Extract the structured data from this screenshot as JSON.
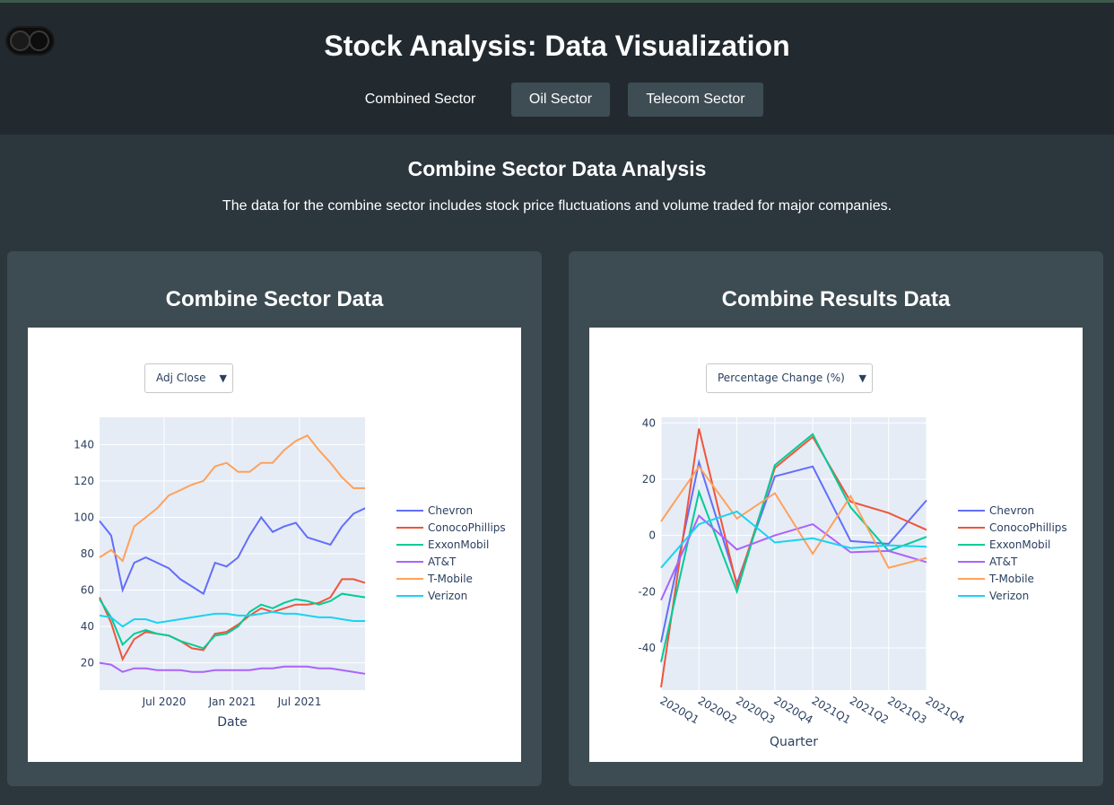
{
  "header": {
    "title": "Stock Analysis: Data Visualization",
    "tabs": [
      {
        "label": "Combined Sector"
      },
      {
        "label": "Oil Sector"
      },
      {
        "label": "Telecom Sector"
      }
    ]
  },
  "section": {
    "title": "Combine Sector Data Analysis",
    "description": "The data for the combine sector includes stock price fluctuations and volume traded for major companies."
  },
  "left_card": {
    "title": "Combine Sector Data",
    "dropdown": "Adj Close"
  },
  "right_card": {
    "title": "Combine Results Data",
    "dropdown": "Percentage Change (%)"
  },
  "colors": {
    "Chevron": "#636efa",
    "ConocoPhillips": "#ef553b",
    "ExxonMobil": "#00cc96",
    "AT&T": "#ab63fa",
    "T-Mobile": "#ffa15a",
    "Verizon": "#19d3f3"
  },
  "chart_data": [
    {
      "type": "line",
      "title": "",
      "xlabel": "Date",
      "ylabel": "",
      "x_ticks": [
        "Jul 2020",
        "Jan 2021",
        "Jul 2021"
      ],
      "y_ticks": [
        20,
        40,
        60,
        80,
        100,
        120,
        140
      ],
      "x": [
        "Jan 2020",
        "Feb 2020",
        "Mar 2020",
        "Apr 2020",
        "May 2020",
        "Jun 2020",
        "Jul 2020",
        "Aug 2020",
        "Sep 2020",
        "Oct 2020",
        "Nov 2020",
        "Dec 2020",
        "Jan 2021",
        "Feb 2021",
        "Mar 2021",
        "Apr 2021",
        "May 2021",
        "Jun 2021",
        "Jul 2021",
        "Aug 2021",
        "Sep 2021",
        "Oct 2021",
        "Nov 2021",
        "Dec 2021"
      ],
      "ylim": [
        5,
        155
      ],
      "legend": "right",
      "series": [
        {
          "name": "Chevron",
          "values": [
            98,
            90,
            60,
            75,
            78,
            75,
            72,
            66,
            62,
            58,
            75,
            73,
            78,
            90,
            100,
            92,
            95,
            97,
            89,
            87,
            85,
            95,
            102,
            105
          ]
        },
        {
          "name": "ConocoPhillips",
          "values": [
            56,
            42,
            22,
            33,
            37,
            36,
            35,
            32,
            28,
            27,
            36,
            37,
            41,
            46,
            50,
            48,
            50,
            52,
            52,
            53,
            56,
            66,
            66,
            64
          ]
        },
        {
          "name": "ExxonMobil",
          "values": [
            55,
            45,
            30,
            36,
            38,
            36,
            35,
            32,
            30,
            28,
            35,
            36,
            40,
            48,
            52,
            50,
            53,
            55,
            54,
            52,
            54,
            58,
            57,
            56
          ]
        },
        {
          "name": "AT&T",
          "values": [
            20,
            19,
            15,
            17,
            17,
            16,
            16,
            16,
            15,
            15,
            16,
            16,
            16,
            16,
            17,
            17,
            18,
            18,
            18,
            17,
            17,
            16,
            15,
            14
          ]
        },
        {
          "name": "T-Mobile",
          "values": [
            78,
            82,
            76,
            95,
            100,
            105,
            112,
            115,
            118,
            120,
            128,
            130,
            125,
            125,
            130,
            130,
            137,
            142,
            145,
            137,
            130,
            122,
            116,
            116
          ]
        },
        {
          "name": "Verizon",
          "values": [
            46,
            45,
            40,
            44,
            44,
            42,
            43,
            44,
            45,
            46,
            47,
            47,
            46,
            46,
            47,
            48,
            47,
            47,
            46,
            45,
            45,
            44,
            43,
            43
          ]
        }
      ]
    },
    {
      "type": "line",
      "title": "",
      "xlabel": "Quarter",
      "ylabel": "",
      "categories": [
        "2020Q1",
        "2020Q2",
        "2020Q3",
        "2020Q4",
        "2021Q1",
        "2021Q2",
        "2021Q3",
        "2021Q4"
      ],
      "y_ticks": [
        -40,
        -20,
        0,
        20,
        40
      ],
      "ylim": [
        -55,
        42
      ],
      "legend": "right",
      "series": [
        {
          "name": "Chevron",
          "values": [
            -38,
            26,
            -17,
            21,
            24.5,
            -2,
            -3,
            12.5
          ]
        },
        {
          "name": "ConocoPhillips",
          "values": [
            -54,
            38,
            -18,
            24,
            35,
            12,
            8,
            2
          ]
        },
        {
          "name": "ExxonMobil",
          "values": [
            -45,
            15.5,
            -20,
            25,
            36,
            10,
            -5.5,
            -0.5
          ]
        },
        {
          "name": "AT&T",
          "values": [
            -23,
            7,
            -5,
            0,
            4,
            -6,
            -5.5,
            -9.5
          ]
        },
        {
          "name": "T-Mobile",
          "values": [
            5,
            24.5,
            6,
            15,
            -6.5,
            14,
            -11.5,
            -8
          ]
        },
        {
          "name": "Verizon",
          "values": [
            -11.5,
            4,
            8.5,
            -2.5,
            -1,
            -4.5,
            -3.5,
            -4
          ]
        }
      ]
    }
  ]
}
